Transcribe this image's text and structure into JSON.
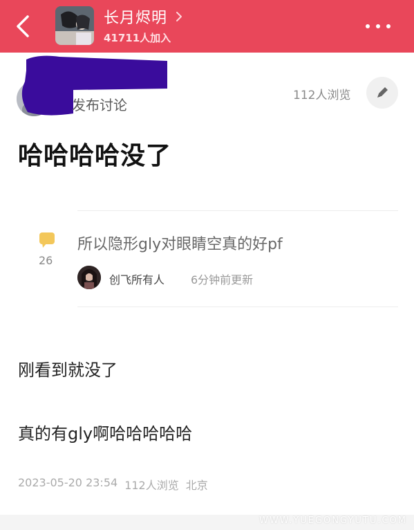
{
  "header": {
    "group_name": "长月烬明",
    "member_count": "41711人加入",
    "accent_color": "#e9475a",
    "back_icon": "chevron-left-icon",
    "more_icon": "more-horizontal-icon"
  },
  "post": {
    "action_label": "发布讨论",
    "view_count": "112人浏览",
    "edit_icon": "pencil-icon",
    "title": "哈哈哈哈没了",
    "linked_discussion": {
      "comment_count": "26",
      "title": "所以隐形gly对眼睛空真的好pf",
      "author": "创飞所有人",
      "updated": "6分钟前更新"
    },
    "body_lines": [
      "刚看到就没了",
      "真的有gly啊哈哈哈哈哈"
    ],
    "meta": {
      "datetime": "2023-05-20 23:54",
      "views": "112人浏览",
      "location": "北京"
    }
  },
  "watermark": "WWW.YUEGONGYUTU.COM"
}
